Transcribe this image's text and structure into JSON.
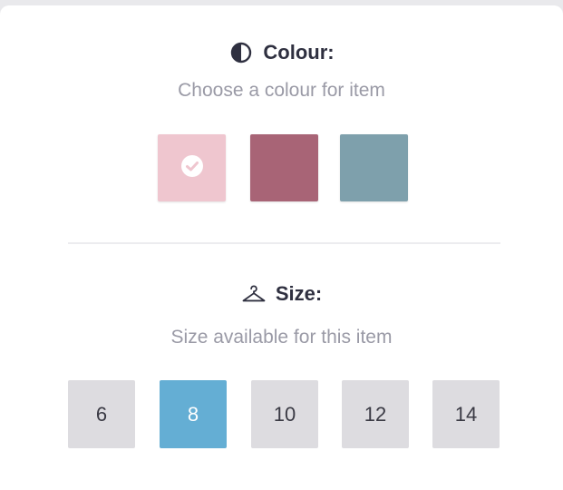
{
  "colour": {
    "title": "Colour:",
    "subtitle": "Choose a colour for item",
    "swatches": [
      {
        "color": "#efc6cf",
        "selected": true
      },
      {
        "color": "#a86476",
        "selected": false
      },
      {
        "color": "#7ea0ac",
        "selected": false
      }
    ]
  },
  "size": {
    "title": "Size:",
    "subtitle": "Size available for this item",
    "options": [
      {
        "label": "6",
        "selected": false
      },
      {
        "label": "8",
        "selected": true
      },
      {
        "label": "10",
        "selected": false
      },
      {
        "label": "12",
        "selected": false
      },
      {
        "label": "14",
        "selected": false
      }
    ]
  },
  "theme": {
    "selected_size": "#64aed4",
    "size_bg": "#dddce0",
    "title_color": "#2f3040",
    "subtitle_color": "#9a9aa6"
  },
  "icons": {
    "colour": "contrast-icon",
    "size": "hanger-icon",
    "swatch_selected": "check-circle-icon"
  }
}
